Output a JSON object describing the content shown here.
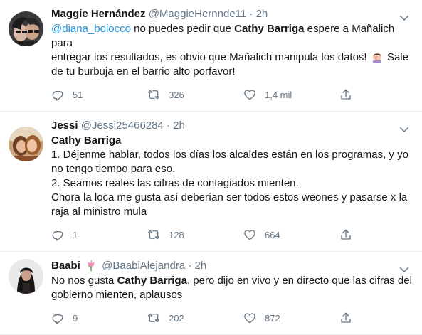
{
  "tweets": [
    {
      "name": "Maggie Hernández",
      "handle": "@MaggieHernnde11",
      "separator": "·",
      "time": "2h",
      "mention": "@diana_bolocco",
      "text_1": " no puedes pedir que ",
      "bold_1": "Cathy Barriga",
      "text_2": " espere a Mañalich para",
      "line_2": "entregar los resultados, es obvio que Mañalich manipula los datos!",
      "line_2_tail": "Sale",
      "line_3": "de tu burbuja en el barrio alto porfavor!",
      "replies": "51",
      "retweets": "326",
      "likes": "1,4 mil"
    },
    {
      "name": "Jessi",
      "handle": "@Jessi25466284",
      "separator": "·",
      "time": "2h",
      "title": "Cathy Barriga",
      "lines": [
        "1. Déjenme hablar, todos los días los alcaldes están en los programas, y yo",
        "no tengo tiempo para eso.",
        "2. Seamos reales las cifras de contagiados mienten.",
        "Chora la loca me gusta así deberían ser todos estos weones y pasarse x la",
        "raja al ministro mula"
      ],
      "replies": "1",
      "retweets": "128",
      "likes": "664"
    },
    {
      "name": "Baabi",
      "handle": "@BaabiAlejandra",
      "separator": "·",
      "time": "2h",
      "text_1": "No nos gusta ",
      "bold_1": "Cathy Barriga",
      "text_2": ", pero dijo en vivo y en directo que las cifras del",
      "line_2": "gobierno mienten, aplausos",
      "replies": "9",
      "retweets": "202",
      "likes": "872"
    }
  ],
  "icons": {
    "reply": "reply-icon",
    "retweet": "retweet-icon",
    "like": "heart-icon",
    "share": "share-icon",
    "caret": "chevron-down-icon"
  },
  "colors": {
    "secondary_text": "#657786",
    "link": "#1b95e0",
    "divider": "#e6ecf0"
  }
}
